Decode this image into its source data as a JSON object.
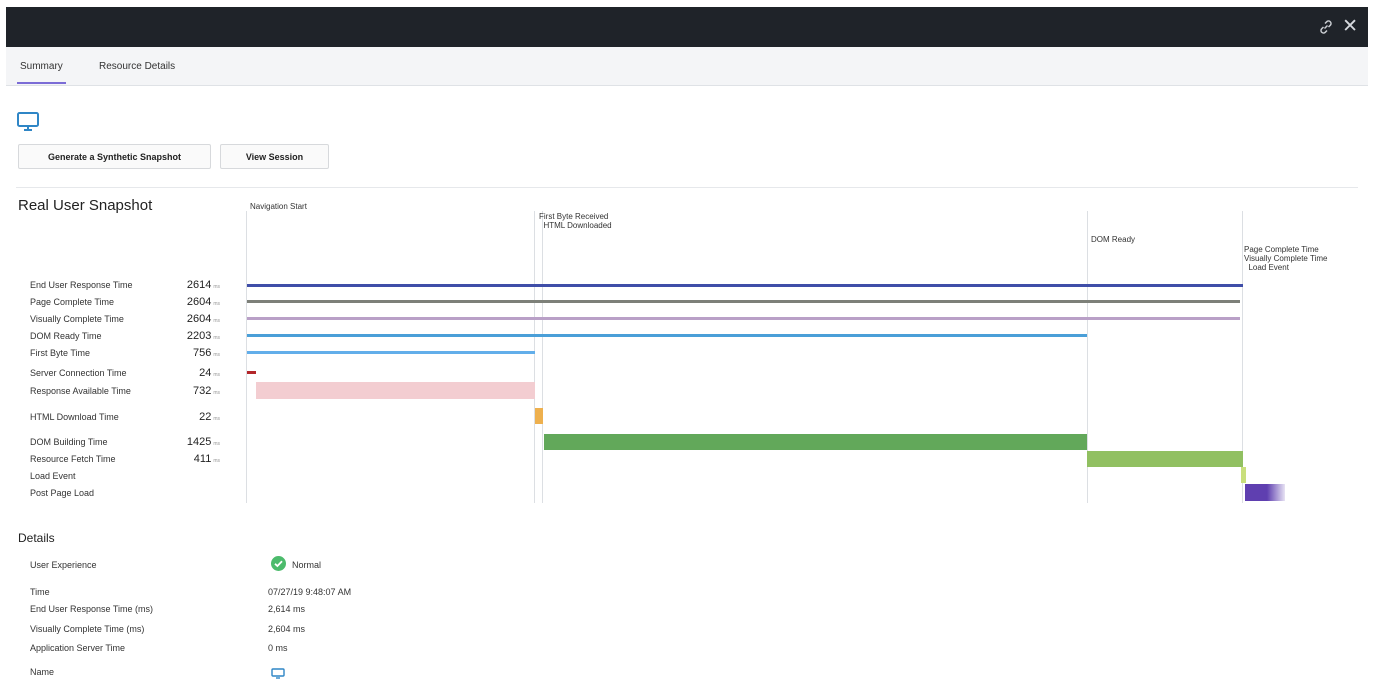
{
  "window": {
    "link_icon": "link-icon",
    "close_label": "✕"
  },
  "tabs": [
    {
      "label": "Summary",
      "active": true
    },
    {
      "label": "Resource Details",
      "active": false
    }
  ],
  "toolbar": {
    "icon": "monitor-icon",
    "generate_label": "Generate a Synthetic Snapshot",
    "view_session_label": "View Session"
  },
  "snapshot": {
    "title": "Real User Snapshot",
    "markers": [
      {
        "label": "Navigation Start"
      },
      {
        "label": "First Byte Received\n  HTML Downloaded"
      },
      {
        "label": "DOM Ready"
      },
      {
        "label": "Page Complete Time\nVisually Complete Time\n  Load Event"
      }
    ],
    "metrics": [
      {
        "label": "End User Response Time",
        "value": "2614",
        "unit": "ms",
        "color": "#3f4ea8"
      },
      {
        "label": "Page Complete Time",
        "value": "2604",
        "unit": "ms",
        "color": "#7d8079"
      },
      {
        "label": "Visually Complete Time",
        "value": "2604",
        "unit": "ms",
        "color": "#b9a0c7"
      },
      {
        "label": "DOM Ready Time",
        "value": "2203",
        "unit": "ms",
        "color": "#4a9fd8"
      },
      {
        "label": "First Byte Time",
        "value": "756",
        "unit": "ms",
        "color": "#62aeea"
      },
      {
        "label": "Server Connection Time",
        "value": "24",
        "unit": "ms",
        "color": "#b3262a"
      },
      {
        "label": "Response Available Time",
        "value": "732",
        "unit": "ms",
        "color": "#f3cdd1"
      },
      {
        "label": "HTML Download Time",
        "value": "22",
        "unit": "ms",
        "color": "#eeb04e"
      },
      {
        "label": "DOM Building Time",
        "value": "1425",
        "unit": "ms",
        "color": "#62a85a"
      },
      {
        "label": "Resource Fetch Time",
        "value": "411",
        "unit": "ms",
        "color": "#91c061"
      },
      {
        "label": "Load Event",
        "value": "",
        "unit": "",
        "color": "#c9df7c"
      },
      {
        "label": "Post Page Load",
        "value": "",
        "unit": "",
        "color": "#5f3fb0"
      }
    ]
  },
  "details": {
    "title": "Details",
    "user_experience_label": "User Experience",
    "user_experience_value": "Normal",
    "user_experience_color": "#4cbb6c",
    "rows": [
      {
        "label": "Time",
        "value": "07/27/19 9:48:07 AM"
      },
      {
        "label": "End User Response Time (ms)",
        "value": "2,614 ms"
      },
      {
        "label": "Visually Complete Time (ms)",
        "value": "2,604 ms"
      },
      {
        "label": "Application Server Time",
        "value": "0 ms"
      }
    ],
    "name_label": "Name",
    "name_icon": "monitor-icon"
  }
}
